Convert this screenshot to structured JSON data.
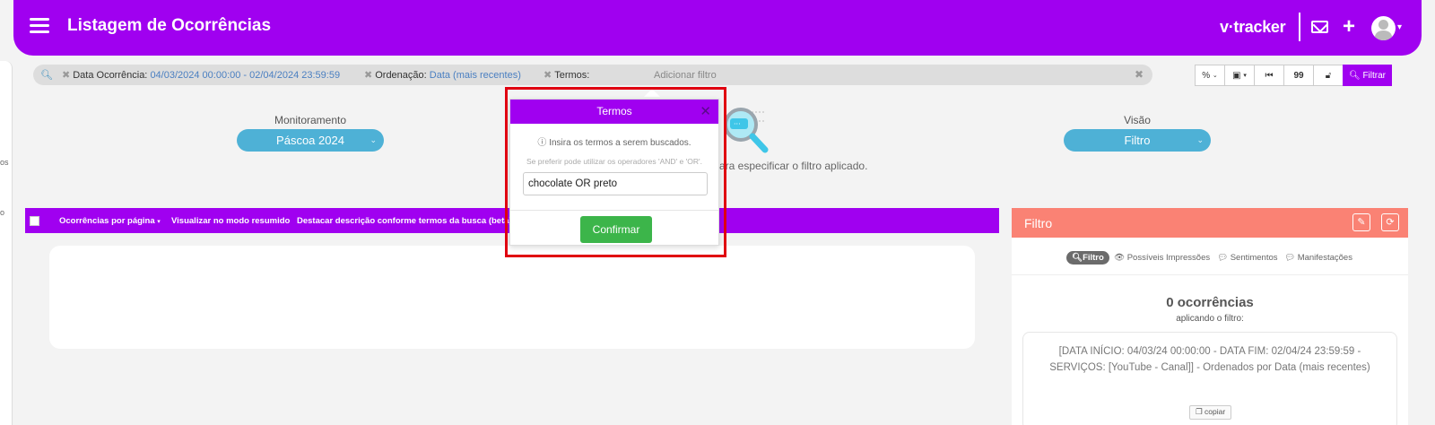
{
  "header": {
    "title": "Listagem de Ocorrências",
    "brand": "v·tracker"
  },
  "sidebar": {
    "fragments": [
      "os",
      "o"
    ]
  },
  "filter_bar": {
    "chips": [
      {
        "label": "Data Ocorrência:",
        "value": "04/03/2024 00:00:00 - 02/04/2024 23:59:59"
      },
      {
        "label": "Ordenação:",
        "value": "Data (mais recentes)"
      },
      {
        "label": "Termos:",
        "value": ""
      }
    ],
    "add_filter": "Adicionar filtro"
  },
  "toolbar": {
    "percent": "%",
    "quote": "99",
    "filter_label": "Filtrar"
  },
  "selectors": {
    "monitoramento": {
      "label": "Monitoramento",
      "value": "Páscoa 2024"
    },
    "visao": {
      "label": "Visão",
      "value": "Filtro"
    }
  },
  "hint": "ara especificar o filtro aplicado.",
  "results_bar": {
    "per_page": "Ocorrências por página",
    "summary_mode": "Visualizar no modo resumido",
    "highlight": "Destacar descrição conforme termos da busca (beta)"
  },
  "termos_popover": {
    "title": "Termos",
    "instruction": "Insira os termos a serem buscados.",
    "note": "Se preferir pode utilizar os operadores 'AND' e 'OR'.",
    "input_value": "chocolate OR preto",
    "confirm": "Confirmar"
  },
  "filtro_panel": {
    "title": "Filtro",
    "tabs": [
      "Filtro",
      "Possíveis Impressões",
      "Sentimentos",
      "Manifestações"
    ],
    "count": "0 ocorrências",
    "subtitle": "aplicando o filtro:",
    "summary": "[DATA INÍCIO: 04/03/24 00:00:00 - DATA FIM: 02/04/24 23:59:59 - SERVIÇOS: [YouTube - Canal]] - Ordenados por Data (mais recentes)",
    "copy": "copiar"
  },
  "colors": {
    "accent": "#a000f0",
    "selector": "#4eb1d6",
    "panel_header": "#fa8274",
    "confirm": "#3cb54a",
    "highlight": "#e00010"
  }
}
